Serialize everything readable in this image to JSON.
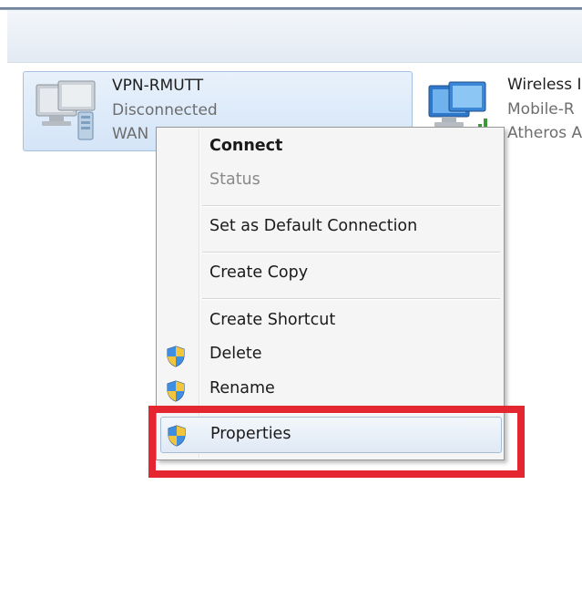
{
  "connections": [
    {
      "name": "VPN-RMUTT",
      "status": "Disconnected",
      "device": "WAN",
      "icon": "vpn-computer-icon",
      "selected": true
    },
    {
      "name": "Wireless I",
      "status": "Mobile-R",
      "device": "Atheros A",
      "icon": "wireless-network-icon",
      "selected": false
    }
  ],
  "context_menu": {
    "connect": "Connect",
    "status": "Status",
    "set_default": "Set as Default Connection",
    "create_copy": "Create Copy",
    "create_shortcut": "Create Shortcut",
    "delete": "Delete",
    "rename": "Rename",
    "properties": "Properties",
    "shield_icon": "uac-shield-icon"
  },
  "colors": {
    "highlight_box": "#e3262f",
    "selection_bg": "#d4e5f8",
    "menu_bg": "#f5f5f5"
  }
}
